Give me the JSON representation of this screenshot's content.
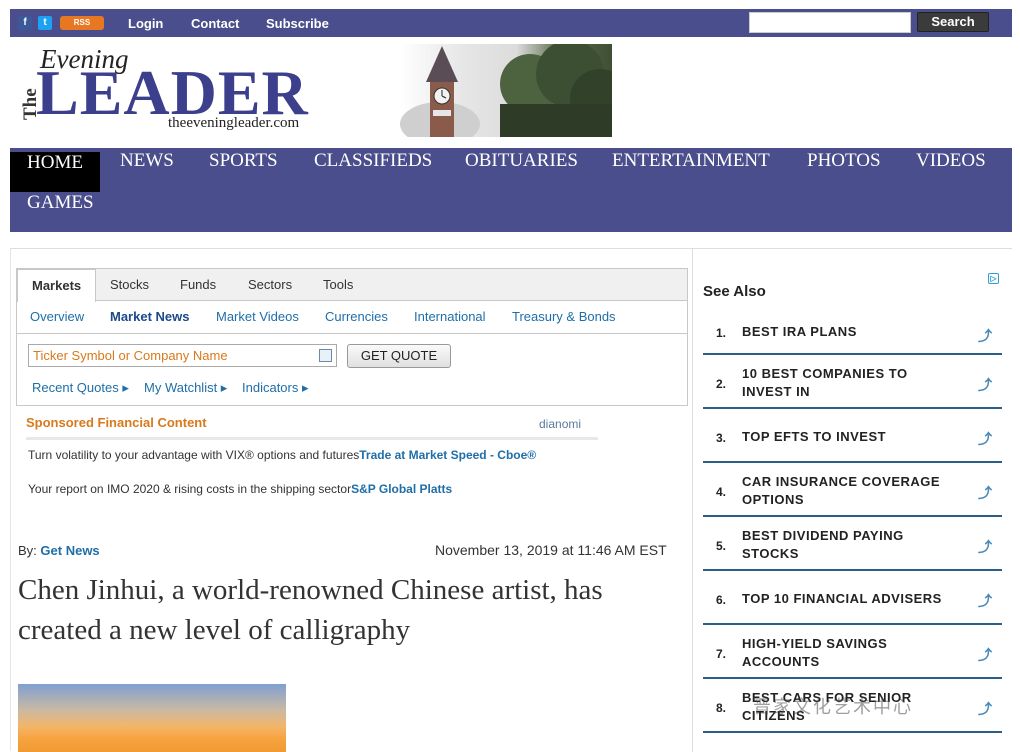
{
  "topbar": {
    "social": [
      {
        "icon": "facebook-icon",
        "glyph": "f"
      },
      {
        "icon": "twitter-icon",
        "glyph": "t"
      },
      {
        "icon": "rss-icon",
        "glyph": "RSS"
      }
    ],
    "links": [
      "Login",
      "Contact",
      "Subscribe"
    ],
    "search_placeholder": "",
    "search_label": "Search"
  },
  "logo": {
    "the": "The",
    "evening": "Evening",
    "leader": "LEADER",
    "url": "theeveningleader.com"
  },
  "nav": {
    "items": [
      "HOME",
      "NEWS",
      "SPORTS",
      "CLASSIFIEDS",
      "OBITUARIES",
      "ENTERTAINMENT",
      "PHOTOS",
      "VIDEOS",
      "GAMES"
    ],
    "active": "HOME"
  },
  "markets": {
    "tabs": [
      "Markets",
      "Stocks",
      "Funds",
      "Sectors",
      "Tools"
    ],
    "subnav": [
      "Overview",
      "Market News",
      "Market Videos",
      "Currencies",
      "International",
      "Treasury & Bonds"
    ],
    "ticker_placeholder": "Ticker Symbol or Company Name",
    "quote_button": "GET QUOTE",
    "links": [
      "Recent Quotes ▸",
      "My Watchlist ▸",
      "Indicators ▸"
    ]
  },
  "sponsored": {
    "title": "Sponsored Financial Content",
    "brand": "dianomi",
    "lines": [
      {
        "text": "Turn volatility to your advantage with VIX® options and futures",
        "link": "Trade at Market Speed - Cboe®"
      },
      {
        "text": "Your report on IMO 2020 & rising costs in the shipping sector",
        "link": "S&P Global Platts"
      }
    ]
  },
  "article": {
    "by_label": "By:",
    "author": "Get News",
    "date": "November 13, 2019 at 11:46 AM EST",
    "headline": "Chen Jinhui, a world-renowned Chinese artist, has created a new level of calligraphy"
  },
  "see_also": {
    "title": "See Also",
    "items": [
      {
        "num": "1.",
        "text": "BEST IRA PLANS"
      },
      {
        "num": "2.",
        "text": "10 BEST COMPANIES TO INVEST IN"
      },
      {
        "num": "3.",
        "text": "TOP EFTS TO INVEST"
      },
      {
        "num": "4.",
        "text": "CAR INSURANCE COVERAGE OPTIONS"
      },
      {
        "num": "5.",
        "text": "BEST DIVIDEND PAYING STOCKS"
      },
      {
        "num": "6.",
        "text": "TOP 10 FINANCIAL ADVISERS"
      },
      {
        "num": "7.",
        "text": "HIGH-YIELD SAVINGS ACCOUNTS"
      },
      {
        "num": "8.",
        "text": "BEST CARS FOR SENIOR CITIZENS"
      }
    ],
    "arrow": "⤴"
  },
  "watermark": "晋家文化艺术中心"
}
